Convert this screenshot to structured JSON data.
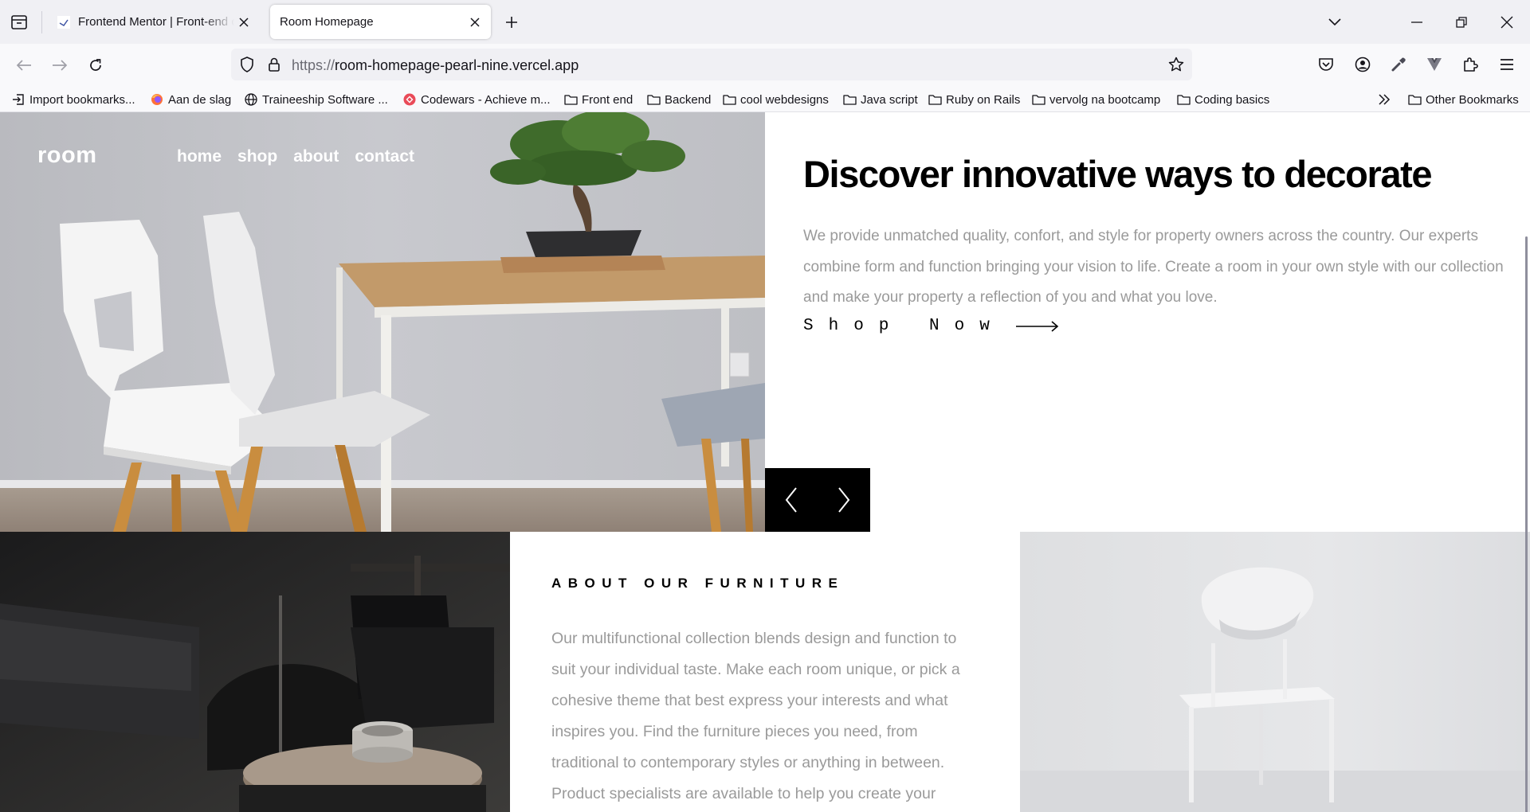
{
  "browser": {
    "tabs": [
      {
        "title": "Frontend Mentor | Front-end coding challenges",
        "active": false
      },
      {
        "title": "Room Homepage",
        "active": true
      }
    ],
    "url_protocol": "https://",
    "url_host": "room-homepage-pearl-nine.vercel.app",
    "bookmarks": [
      {
        "label": "Import bookmarks...",
        "icon": "import-icon"
      },
      {
        "label": "Aan de slag",
        "icon": "firefox-icon"
      },
      {
        "label": "Traineeship Software ...",
        "icon": "globe-icon"
      },
      {
        "label": "Codewars - Achieve m...",
        "icon": "codewars-icon"
      },
      {
        "label": "Front end",
        "icon": "folder-icon"
      },
      {
        "label": "Backend",
        "icon": "folder-icon"
      },
      {
        "label": "cool webdesigns",
        "icon": "folder-icon"
      },
      {
        "label": "Java script",
        "icon": "folder-icon"
      },
      {
        "label": "Ruby on Rails",
        "icon": "folder-icon"
      },
      {
        "label": "vervolg na bootcamp",
        "icon": "folder-icon"
      },
      {
        "label": "Coding basics",
        "icon": "folder-icon"
      }
    ],
    "other_bookmarks": "Other Bookmarks"
  },
  "site": {
    "logo": "room",
    "nav": [
      "home",
      "shop",
      "about",
      "contact"
    ],
    "hero": {
      "title": "Discover innovative ways to decorate",
      "description": "We provide unmatched quality, confort, and style for property owners across the country. Our experts combine form and function bringing your vision to life. Create a room in your own style with our collection and make your property a reflection of you and what you love.",
      "cta": "Shop Now"
    },
    "about": {
      "title": "ABOUT OUR FURNITURE",
      "body": "Our multifunctional collection blends design and function to suit your individual taste. Make each room unique, or pick a cohesive theme that best express your interests and what inspires you. Find the furniture pieces you need, from traditional to contemporary styles or anything in between. Product specialists are available to help you create your dream space."
    }
  },
  "colors": {
    "accent": "#000000",
    "muted_text": "#9a9a9a",
    "chrome_bg": "#f0f0f4"
  }
}
